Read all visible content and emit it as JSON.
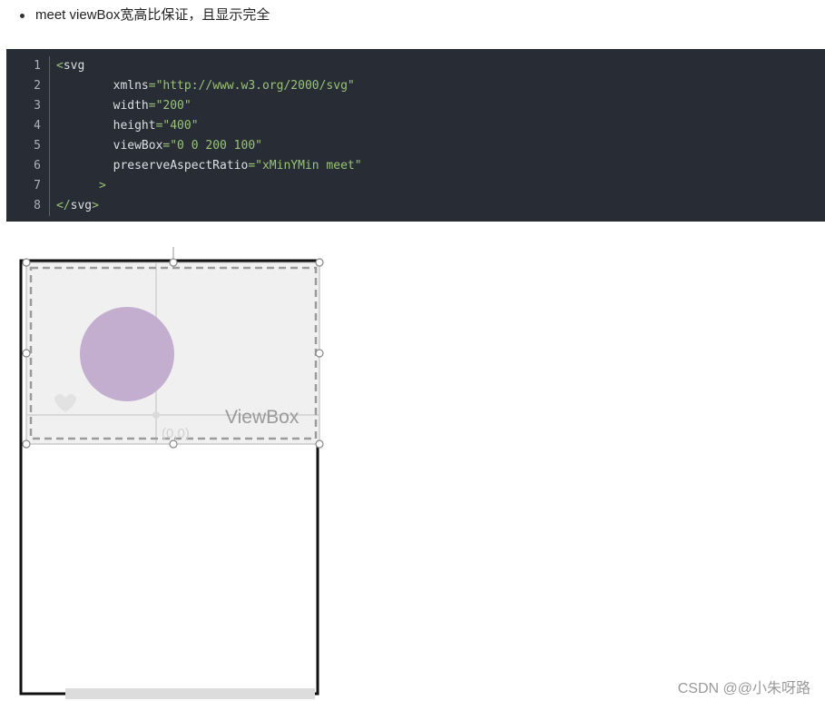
{
  "bullet": {
    "text": "meet viewBox宽高比保证，且显示完全"
  },
  "code": {
    "line_numbers": [
      "1",
      "2",
      "3",
      "4",
      "5",
      "6",
      "7",
      "8"
    ],
    "lines": [
      {
        "parts": [
          {
            "c": "tag",
            "t": "<"
          },
          {
            "c": "tagname",
            "t": "svg"
          }
        ]
      },
      {
        "parts": [
          {
            "c": "attr",
            "t": "        xmlns"
          },
          {
            "c": "eq",
            "t": "="
          },
          {
            "c": "str",
            "t": "\"http://www.w3.org/2000/svg\""
          }
        ]
      },
      {
        "parts": [
          {
            "c": "attr",
            "t": "        width"
          },
          {
            "c": "eq",
            "t": "="
          },
          {
            "c": "str",
            "t": "\"200\""
          }
        ]
      },
      {
        "parts": [
          {
            "c": "attr",
            "t": "        height"
          },
          {
            "c": "eq",
            "t": "="
          },
          {
            "c": "str",
            "t": "\"400\""
          }
        ]
      },
      {
        "parts": [
          {
            "c": "attr",
            "t": "        viewBox"
          },
          {
            "c": "eq",
            "t": "="
          },
          {
            "c": "str",
            "t": "\"0 0 200 100\""
          }
        ]
      },
      {
        "parts": [
          {
            "c": "attr",
            "t": "        preserveAspectRatio"
          },
          {
            "c": "eq",
            "t": "="
          },
          {
            "c": "str",
            "t": "\"xMinYMin meet\""
          }
        ]
      },
      {
        "parts": [
          {
            "c": "tag",
            "t": "      >"
          }
        ]
      },
      {
        "parts": [
          {
            "c": "tag",
            "t": "</"
          },
          {
            "c": "tagname",
            "t": "svg"
          },
          {
            "c": "tag",
            "t": ">"
          }
        ]
      }
    ]
  },
  "illustration": {
    "viewbox_label": "ViewBox",
    "origin_label": "(0,0)",
    "circle_color": "#c3aed0"
  },
  "watermark": {
    "text": "CSDN @@小朱呀路"
  }
}
